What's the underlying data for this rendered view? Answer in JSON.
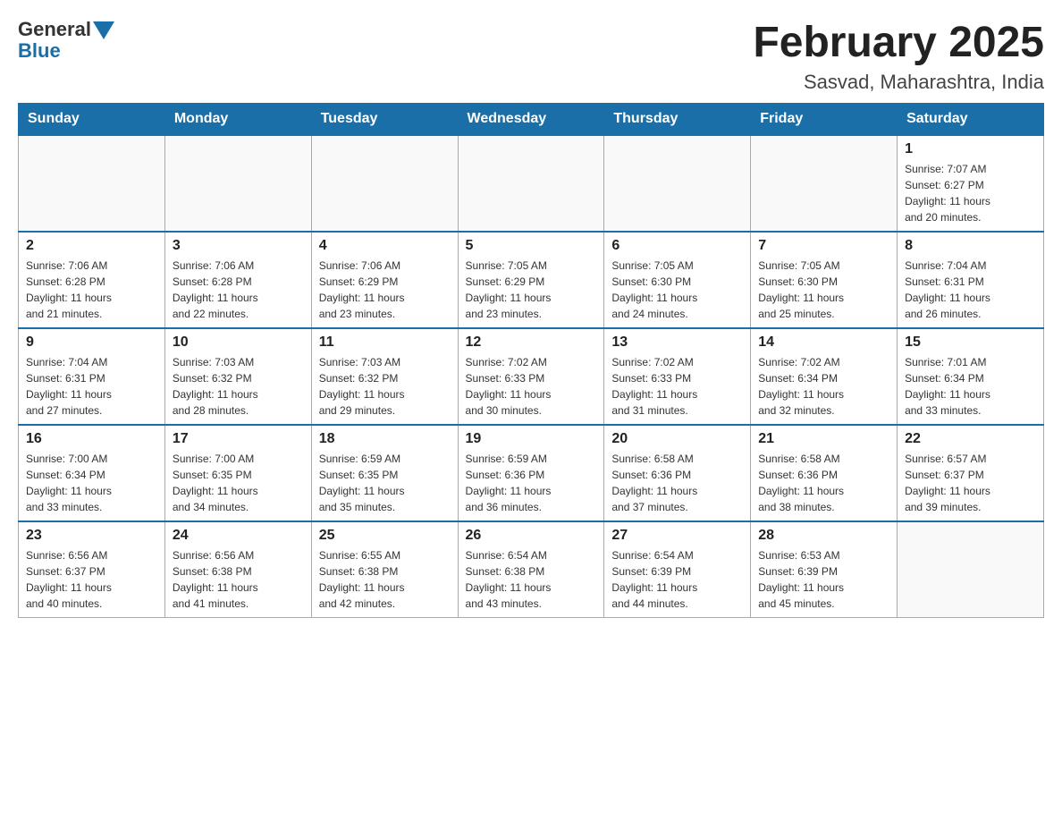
{
  "header": {
    "logo_general": "General",
    "logo_blue": "Blue",
    "month_title": "February 2025",
    "location": "Sasvad, Maharashtra, India"
  },
  "weekdays": [
    "Sunday",
    "Monday",
    "Tuesday",
    "Wednesday",
    "Thursday",
    "Friday",
    "Saturday"
  ],
  "weeks": [
    [
      {
        "day": "",
        "info": ""
      },
      {
        "day": "",
        "info": ""
      },
      {
        "day": "",
        "info": ""
      },
      {
        "day": "",
        "info": ""
      },
      {
        "day": "",
        "info": ""
      },
      {
        "day": "",
        "info": ""
      },
      {
        "day": "1",
        "info": "Sunrise: 7:07 AM\nSunset: 6:27 PM\nDaylight: 11 hours\nand 20 minutes."
      }
    ],
    [
      {
        "day": "2",
        "info": "Sunrise: 7:06 AM\nSunset: 6:28 PM\nDaylight: 11 hours\nand 21 minutes."
      },
      {
        "day": "3",
        "info": "Sunrise: 7:06 AM\nSunset: 6:28 PM\nDaylight: 11 hours\nand 22 minutes."
      },
      {
        "day": "4",
        "info": "Sunrise: 7:06 AM\nSunset: 6:29 PM\nDaylight: 11 hours\nand 23 minutes."
      },
      {
        "day": "5",
        "info": "Sunrise: 7:05 AM\nSunset: 6:29 PM\nDaylight: 11 hours\nand 23 minutes."
      },
      {
        "day": "6",
        "info": "Sunrise: 7:05 AM\nSunset: 6:30 PM\nDaylight: 11 hours\nand 24 minutes."
      },
      {
        "day": "7",
        "info": "Sunrise: 7:05 AM\nSunset: 6:30 PM\nDaylight: 11 hours\nand 25 minutes."
      },
      {
        "day": "8",
        "info": "Sunrise: 7:04 AM\nSunset: 6:31 PM\nDaylight: 11 hours\nand 26 minutes."
      }
    ],
    [
      {
        "day": "9",
        "info": "Sunrise: 7:04 AM\nSunset: 6:31 PM\nDaylight: 11 hours\nand 27 minutes."
      },
      {
        "day": "10",
        "info": "Sunrise: 7:03 AM\nSunset: 6:32 PM\nDaylight: 11 hours\nand 28 minutes."
      },
      {
        "day": "11",
        "info": "Sunrise: 7:03 AM\nSunset: 6:32 PM\nDaylight: 11 hours\nand 29 minutes."
      },
      {
        "day": "12",
        "info": "Sunrise: 7:02 AM\nSunset: 6:33 PM\nDaylight: 11 hours\nand 30 minutes."
      },
      {
        "day": "13",
        "info": "Sunrise: 7:02 AM\nSunset: 6:33 PM\nDaylight: 11 hours\nand 31 minutes."
      },
      {
        "day": "14",
        "info": "Sunrise: 7:02 AM\nSunset: 6:34 PM\nDaylight: 11 hours\nand 32 minutes."
      },
      {
        "day": "15",
        "info": "Sunrise: 7:01 AM\nSunset: 6:34 PM\nDaylight: 11 hours\nand 33 minutes."
      }
    ],
    [
      {
        "day": "16",
        "info": "Sunrise: 7:00 AM\nSunset: 6:34 PM\nDaylight: 11 hours\nand 33 minutes."
      },
      {
        "day": "17",
        "info": "Sunrise: 7:00 AM\nSunset: 6:35 PM\nDaylight: 11 hours\nand 34 minutes."
      },
      {
        "day": "18",
        "info": "Sunrise: 6:59 AM\nSunset: 6:35 PM\nDaylight: 11 hours\nand 35 minutes."
      },
      {
        "day": "19",
        "info": "Sunrise: 6:59 AM\nSunset: 6:36 PM\nDaylight: 11 hours\nand 36 minutes."
      },
      {
        "day": "20",
        "info": "Sunrise: 6:58 AM\nSunset: 6:36 PM\nDaylight: 11 hours\nand 37 minutes."
      },
      {
        "day": "21",
        "info": "Sunrise: 6:58 AM\nSunset: 6:36 PM\nDaylight: 11 hours\nand 38 minutes."
      },
      {
        "day": "22",
        "info": "Sunrise: 6:57 AM\nSunset: 6:37 PM\nDaylight: 11 hours\nand 39 minutes."
      }
    ],
    [
      {
        "day": "23",
        "info": "Sunrise: 6:56 AM\nSunset: 6:37 PM\nDaylight: 11 hours\nand 40 minutes."
      },
      {
        "day": "24",
        "info": "Sunrise: 6:56 AM\nSunset: 6:38 PM\nDaylight: 11 hours\nand 41 minutes."
      },
      {
        "day": "25",
        "info": "Sunrise: 6:55 AM\nSunset: 6:38 PM\nDaylight: 11 hours\nand 42 minutes."
      },
      {
        "day": "26",
        "info": "Sunrise: 6:54 AM\nSunset: 6:38 PM\nDaylight: 11 hours\nand 43 minutes."
      },
      {
        "day": "27",
        "info": "Sunrise: 6:54 AM\nSunset: 6:39 PM\nDaylight: 11 hours\nand 44 minutes."
      },
      {
        "day": "28",
        "info": "Sunrise: 6:53 AM\nSunset: 6:39 PM\nDaylight: 11 hours\nand 45 minutes."
      },
      {
        "day": "",
        "info": ""
      }
    ]
  ]
}
